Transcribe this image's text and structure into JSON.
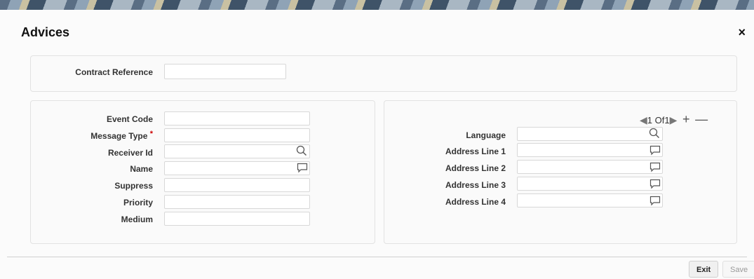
{
  "window": {
    "title": "Advices",
    "close_label": "×"
  },
  "contract_panel": {
    "contract_reference_label": "Contract Reference",
    "contract_reference_value": ""
  },
  "left_panel": {
    "event_code_label": "Event Code",
    "message_type_label": "Message Type",
    "required_marker": "*",
    "receiver_id_label": "Receiver Id",
    "name_label": "Name",
    "suppress_label": "Suppress",
    "priority_label": "Priority",
    "medium_label": "Medium"
  },
  "right_panel": {
    "pagination": {
      "current": "1",
      "of_label": "Of",
      "total": "1"
    },
    "language_label": "Language",
    "address_line_1_label": "Address Line 1",
    "address_line_2_label": "Address Line 2",
    "address_line_3_label": "Address Line 3",
    "address_line_4_label": "Address Line 4"
  },
  "footer": {
    "exit_label": "Exit",
    "save_label": "Save"
  }
}
